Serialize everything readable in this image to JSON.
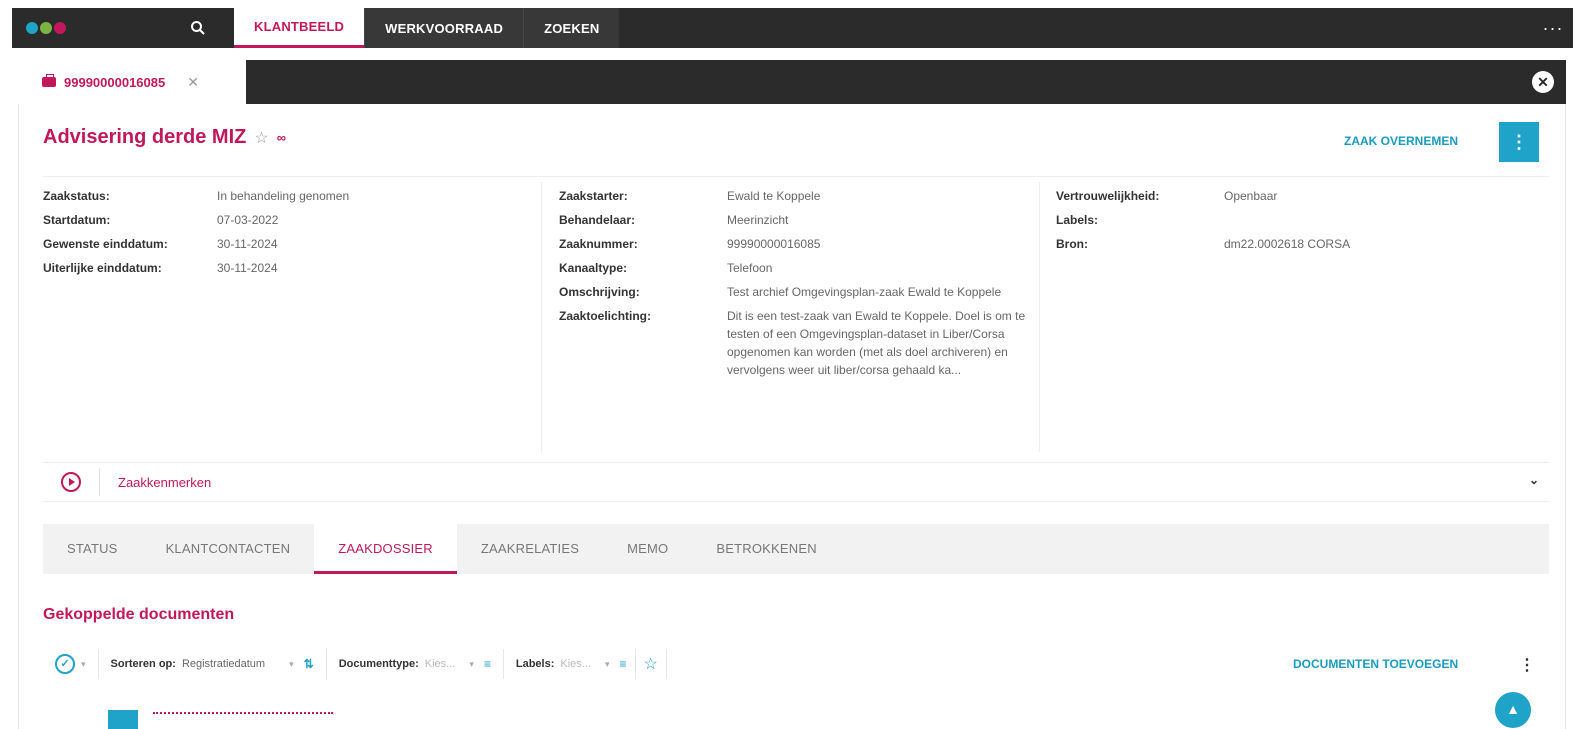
{
  "topnav": {
    "logo_colors": [
      "#1fa3c8",
      "#7cb342",
      "#c2185b"
    ],
    "tabs": [
      {
        "label": "KLANTBEELD",
        "active": true
      },
      {
        "label": "WERKVOORRAAD",
        "active": false
      },
      {
        "label": "ZOEKEN",
        "active": false
      }
    ]
  },
  "case_tab": {
    "label": "99990000016085"
  },
  "header": {
    "title": "Advisering derde MIZ",
    "takeover_label": "ZAAK OVERNEMEN"
  },
  "details": {
    "col1": [
      {
        "label": "Zaakstatus:",
        "value": "In behandeling genomen"
      },
      {
        "label": "Startdatum:",
        "value": "07-03-2022"
      },
      {
        "label": "Gewenste einddatum:",
        "value": "30-11-2024"
      },
      {
        "label": "Uiterlijke einddatum:",
        "value": "30-11-2024"
      }
    ],
    "col2": [
      {
        "label": "Zaakstarter:",
        "value": "Ewald te Koppele"
      },
      {
        "label": "Behandelaar:",
        "value": "Meerinzicht"
      },
      {
        "label": "Zaaknummer:",
        "value": "99990000016085"
      },
      {
        "label": "Kanaaltype:",
        "value": "Telefoon"
      },
      {
        "label": "Omschrijving:",
        "value": "Test archief Omgevingsplan-zaak Ewald te Koppele"
      },
      {
        "label": "Zaaktoelichting:",
        "value": "Dit is een test-zaak van Ewald te Koppele. Doel is om te testen of een Omgevingsplan-dataset in Liber/Corsa opgenomen kan worden (met als doel archiveren) en vervolgens weer uit liber/corsa gehaald ka..."
      }
    ],
    "col3": [
      {
        "label": "Vertrouwelijkheid:",
        "value": "Openbaar"
      },
      {
        "label": "Labels:",
        "value": ""
      },
      {
        "label": "Bron:",
        "value": "dm22.0002618 CORSA"
      }
    ]
  },
  "zaakkenmerken": {
    "label": "Zaakkenmerken"
  },
  "detail_tabs": [
    {
      "label": "STATUS",
      "active": false
    },
    {
      "label": "KLANTCONTACTEN",
      "active": false
    },
    {
      "label": "ZAAKDOSSIER",
      "active": true
    },
    {
      "label": "ZAAKRELATIES",
      "active": false
    },
    {
      "label": "MEMO",
      "active": false
    },
    {
      "label": "BETROKKENEN",
      "active": false
    }
  ],
  "documents": {
    "section_title": "Gekoppelde documenten",
    "sort_label": "Sorteren op:",
    "sort_value": "Registratiedatum",
    "doctype_label": "Documenttype:",
    "doctype_placeholder": "Kies...",
    "labels_label": "Labels:",
    "labels_placeholder": "Kies...",
    "add_label": "DOCUMENTEN TOEVOEGEN"
  },
  "colors": {
    "accent": "#c2185b",
    "action": "#1fa3c8",
    "nav_bg": "#2b2b2b"
  }
}
